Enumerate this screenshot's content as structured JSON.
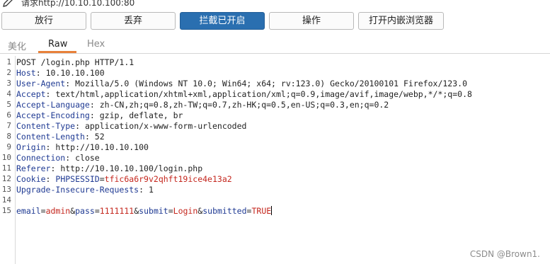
{
  "top": {
    "request_label": "请求http://10.10.10.100:80"
  },
  "toolbar": {
    "forward": "放行",
    "drop": "丢弃",
    "intercept": "拦截已开启",
    "action": "操作",
    "open_browser": "打开内嵌浏览器",
    "accent_color": "#2a6fb0"
  },
  "tabs": {
    "pretty": "美化",
    "raw": "Raw",
    "hex": "Hex",
    "selected": "Raw",
    "underline_color": "#e8813a"
  },
  "request": {
    "line_numbers": [
      "1",
      "2",
      "3",
      "4",
      "5",
      "6",
      "7",
      "8",
      "9",
      "10",
      "11",
      "12",
      "13",
      "14",
      "15"
    ],
    "request_line": "POST /login.php HTTP/1.1",
    "headers": [
      {
        "name": "Host",
        "value": "10.10.10.100"
      },
      {
        "name": "User-Agent",
        "value": "Mozilla/5.0 (Windows NT 10.0; Win64; x64; rv:123.0) Gecko/20100101 Firefox/123.0"
      },
      {
        "name": "Accept",
        "value": "text/html,application/xhtml+xml,application/xml;q=0.9,image/avif,image/webp,*/*;q=0.8"
      },
      {
        "name": "Accept-Language",
        "value": "zh-CN,zh;q=0.8,zh-TW;q=0.7,zh-HK;q=0.5,en-US;q=0.3,en;q=0.2"
      },
      {
        "name": "Accept-Encoding",
        "value": "gzip, deflate, br"
      },
      {
        "name": "Content-Type",
        "value": "application/x-www-form-urlencoded"
      },
      {
        "name": "Content-Length",
        "value": "52"
      },
      {
        "name": "Origin",
        "value": "http://10.10.10.100"
      },
      {
        "name": "Connection",
        "value": "close"
      },
      {
        "name": "Referer",
        "value": "http://10.10.10.100/login.php"
      }
    ],
    "cookie": {
      "name": "Cookie",
      "key": "PHPSESSID",
      "value": "tfic6a6r9v2qhft19ice4e13a2"
    },
    "upgrade": {
      "name": "Upgrade-Insecure-Requests",
      "value": "1"
    },
    "body": [
      {
        "key": "email",
        "value": "admin"
      },
      {
        "key": "pass",
        "value": "1111111"
      },
      {
        "key": "submit",
        "value": "Login"
      },
      {
        "key": "submitted",
        "value": "TRUE"
      }
    ],
    "colors": {
      "key": "#1f3a93",
      "param_value": "#c4261d"
    }
  },
  "watermark": "CSDN @Brown1."
}
